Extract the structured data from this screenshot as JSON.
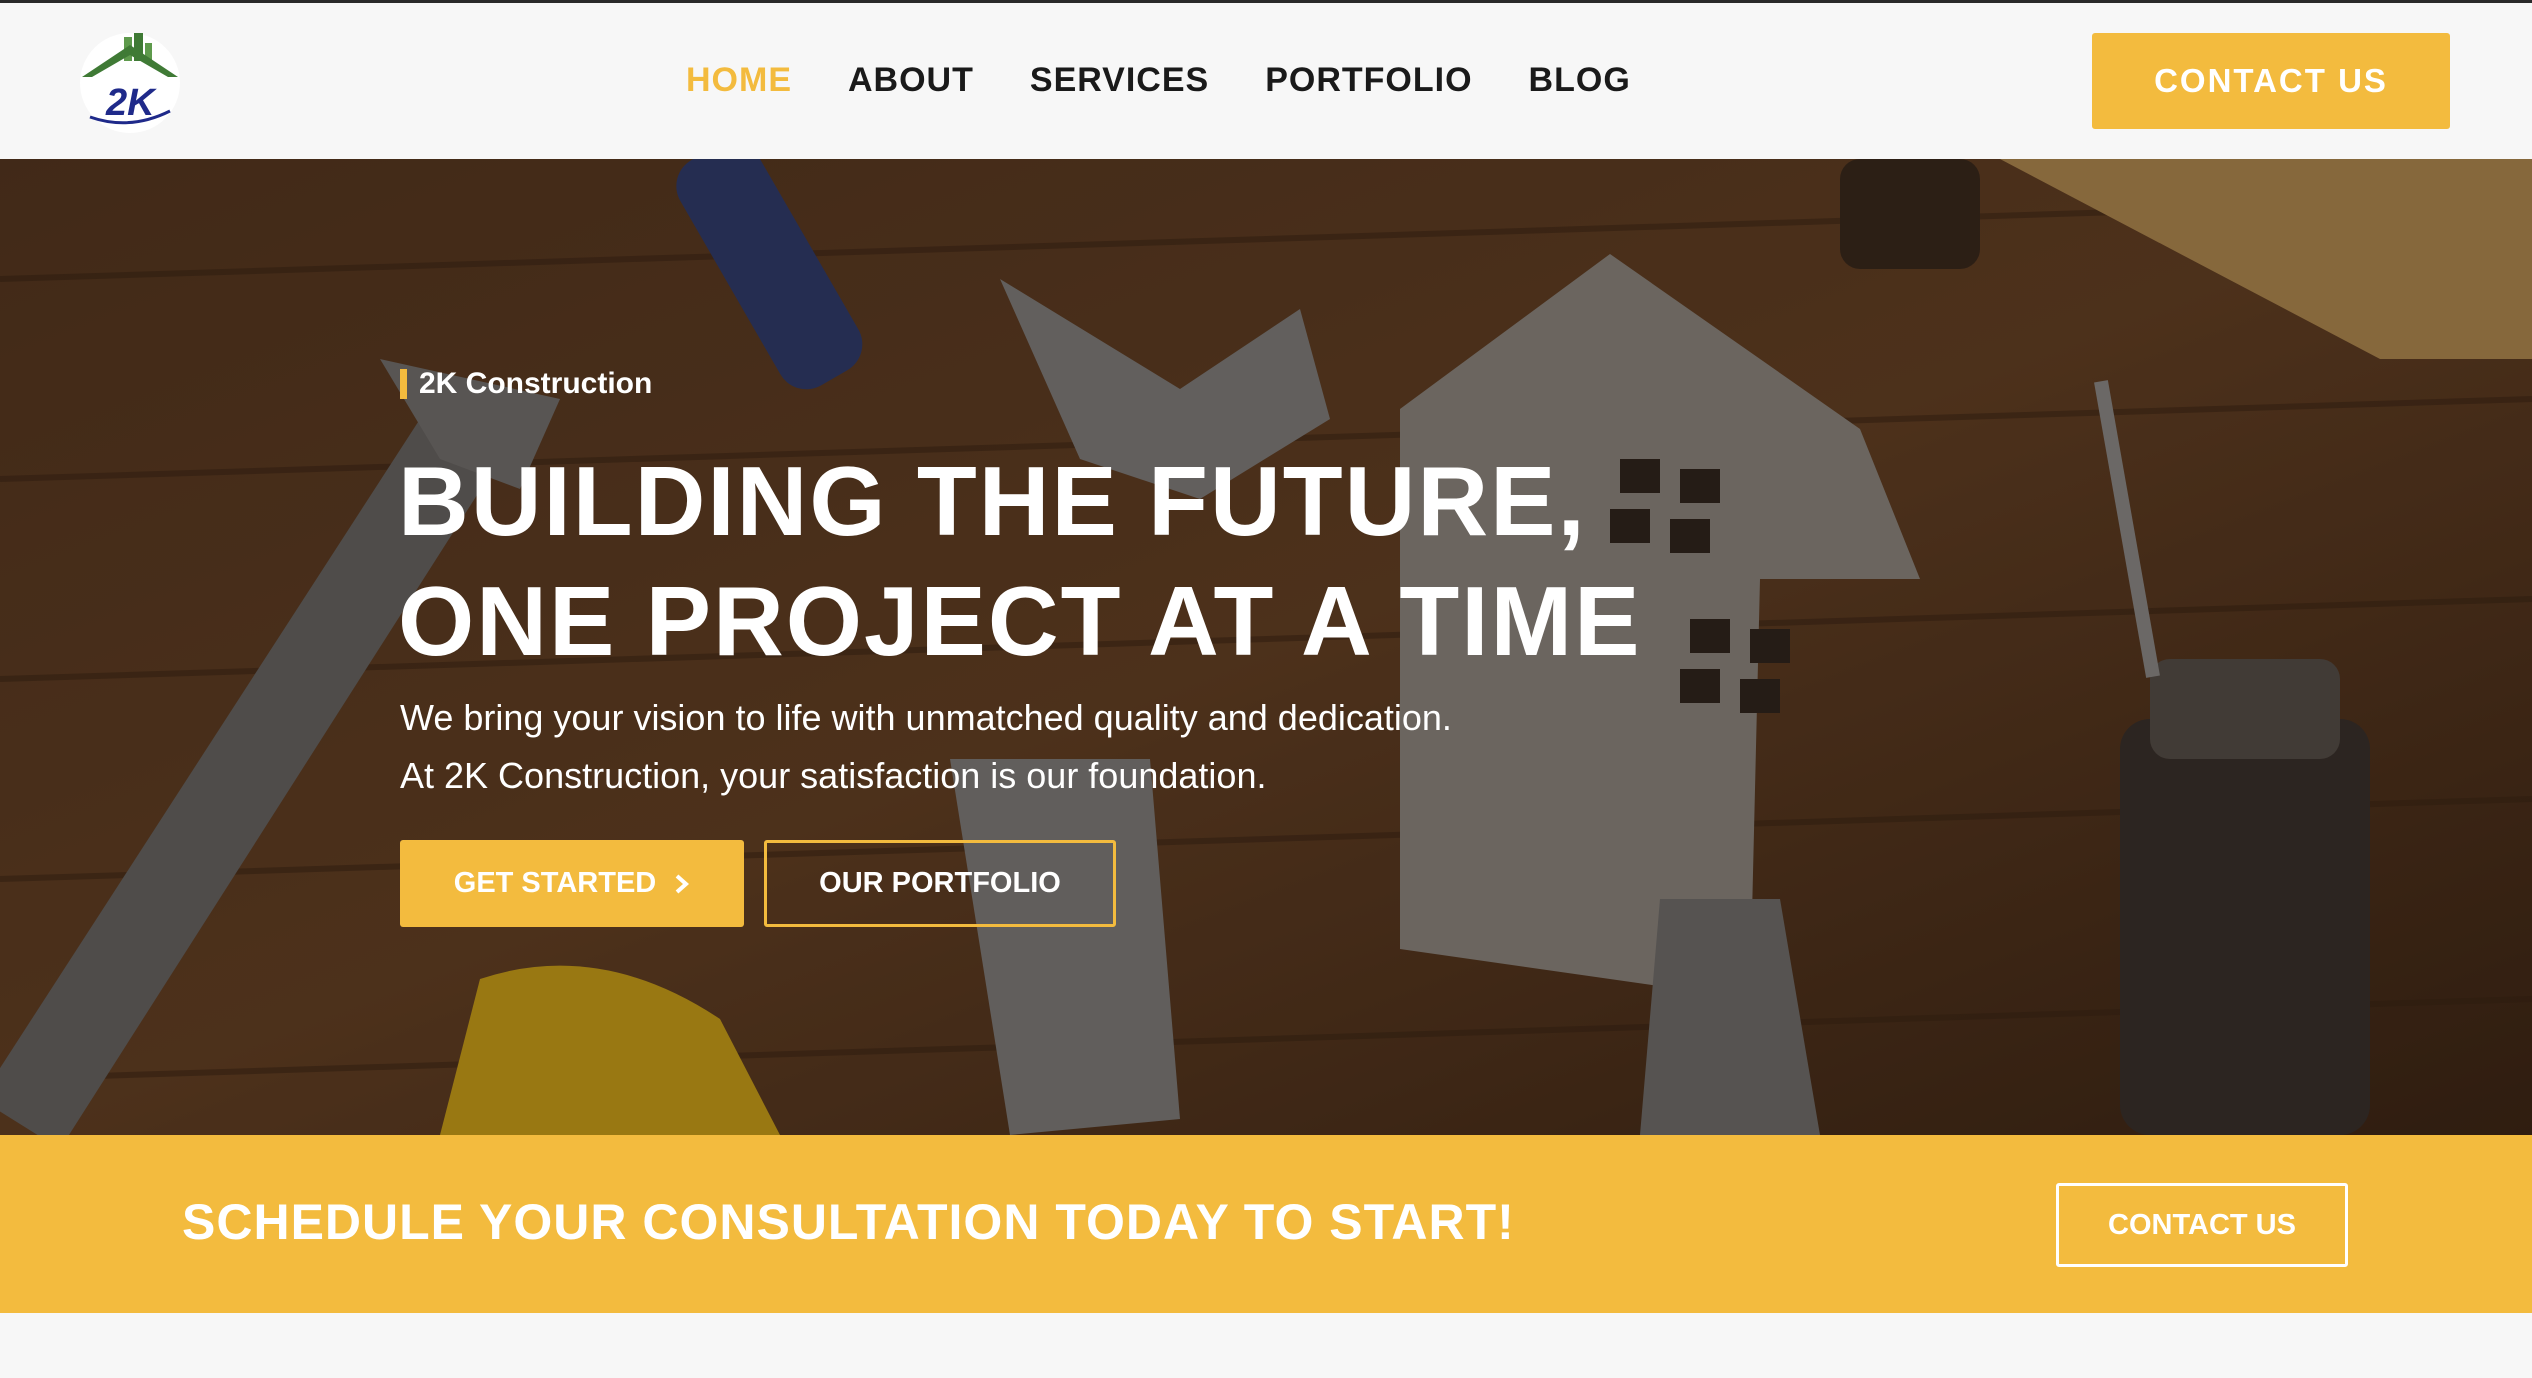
{
  "brand": {
    "logo_text": "2K"
  },
  "nav": {
    "items": [
      {
        "label": "HOME",
        "active": true
      },
      {
        "label": "ABOUT"
      },
      {
        "label": "SERVICES"
      },
      {
        "label": "PORTFOLIO"
      },
      {
        "label": "BLOG"
      }
    ],
    "cta_label": "CONTACT US"
  },
  "hero": {
    "eyebrow": "2K Construction",
    "title_line1": "BUILDING THE FUTURE,",
    "title_line2": "ONE PROJECT AT A TIME",
    "subtitle_line1": "We bring your vision to life with unmatched quality and dedication.",
    "subtitle_line2": "At 2K Construction, your satisfaction is our foundation.",
    "primary_button": "GET STARTED",
    "secondary_button": "OUR PORTFOLIO"
  },
  "cta_band": {
    "text": "SCHEDULE YOUR CONSULTATION TODAY TO START!",
    "button": "CONTACT US"
  },
  "colors": {
    "accent": "#f3bb3e",
    "header_bg": "#f7f7f7",
    "text_dark": "#1a1a1a",
    "logo_blue": "#1f2a8a",
    "logo_green": "#3f7a35"
  }
}
